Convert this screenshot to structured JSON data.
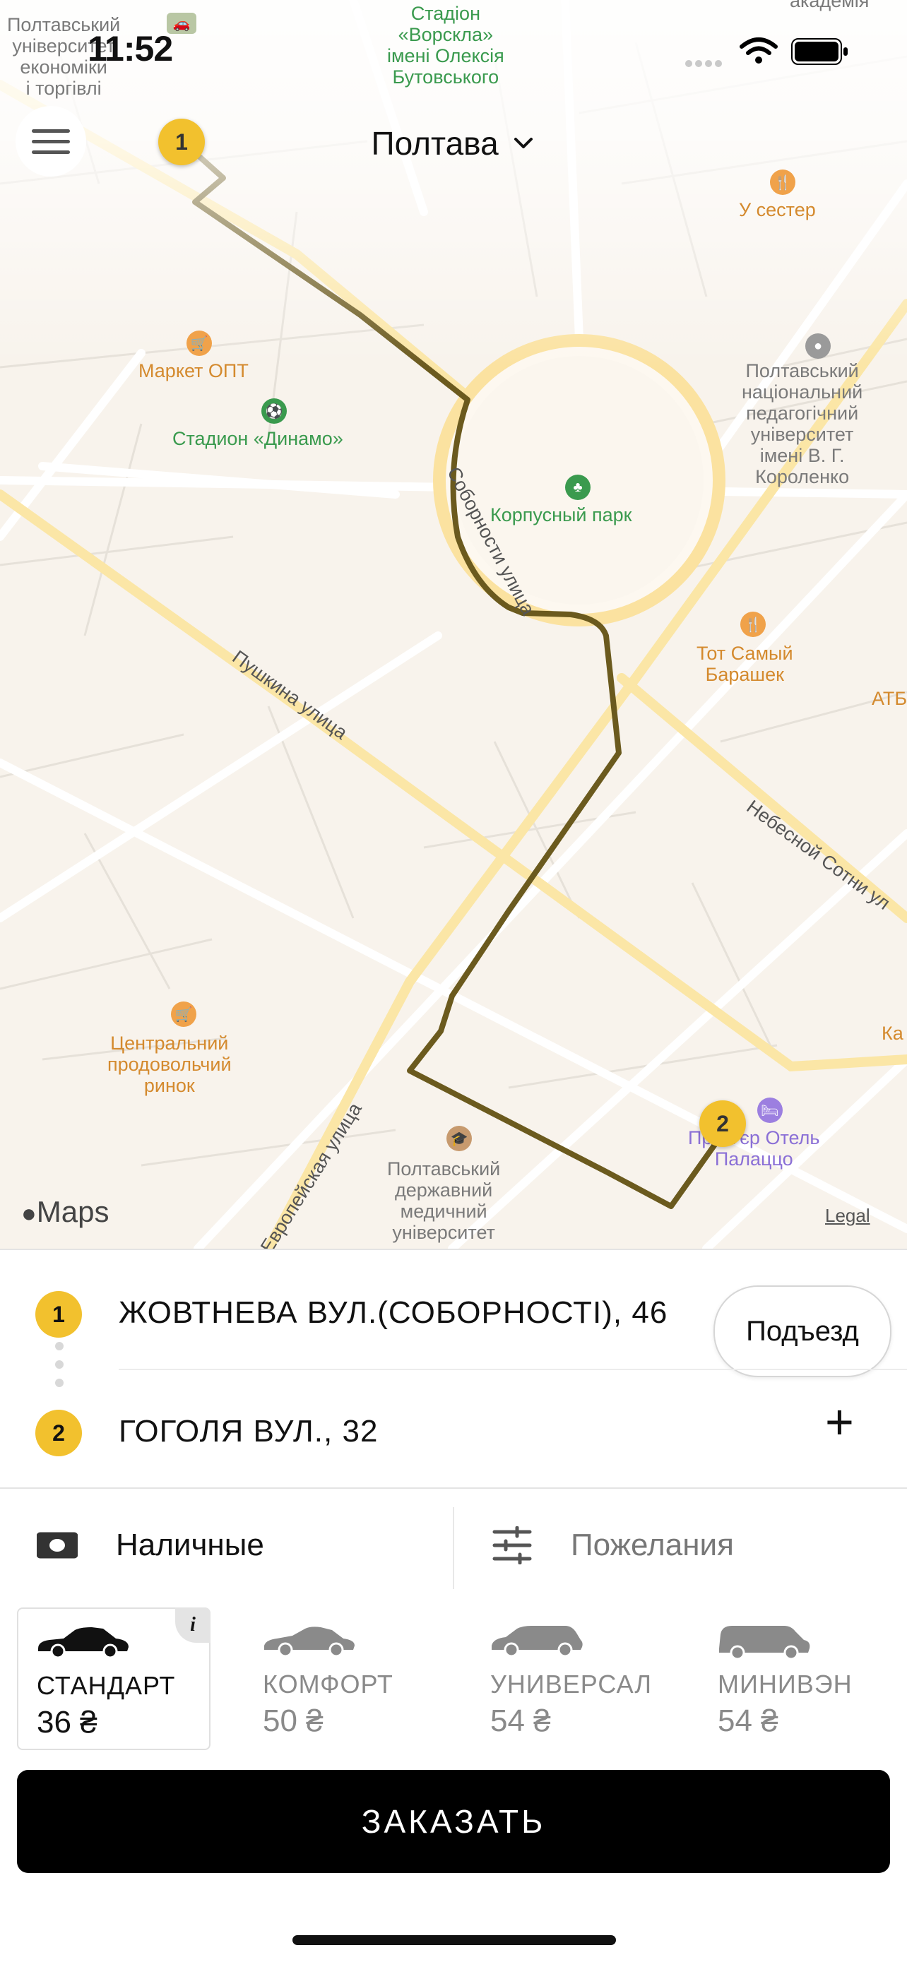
{
  "status_bar": {
    "time": "11:52"
  },
  "header": {
    "city": "Полтава"
  },
  "map": {
    "labels": {
      "top_left": "Полтавський\nуніверситет\nекономіки\nі торгівлі",
      "stadium_vorskla": "Стадіон\n«Ворскла»\nімені Олексія\nБутовського",
      "academy": "академія",
      "u_sester": "У сестер",
      "market_opt": "Маркет ОПТ",
      "stadium_dynamo": "Стадион «Динамо»",
      "pedagogical": "Полтавський\nнаціональний\nпедагогічний\nуніверситет\nімені В. Г.\nКороленко",
      "korpusny_park": "Корпусный парк",
      "tot_samy_barashek": "Тот Самый\nБарашек",
      "ate": "АТБ",
      "central_market": "Центральний\nпродовольчий\nринок",
      "medical_university": "Полтавський\nдержавний\nмедичний\nуніверситет",
      "hotel": "Прем'єр Отель\nПалаццо",
      "ka": "Ка"
    },
    "streets": {
      "sobornosti": "Соборности улица",
      "pushkina": "Пушкина улица",
      "nebesnoy_sotni": "Небесной Сотни ул",
      "evropeyskaya": "Европейская улица"
    },
    "pins": [
      "1",
      "2"
    ],
    "attribution": "Maps",
    "legal": "Legal",
    "route_color": "#6b5a1e"
  },
  "addresses": [
    {
      "index": "1",
      "text": "ЖОВТНЕВА  ВУЛ.(СОБОРНОСТІ), 46",
      "action": "Подъезд"
    },
    {
      "index": "2",
      "text": "ГОГОЛЯ ВУЛ., 32",
      "action": "+"
    }
  ],
  "options": {
    "payment": "Наличные",
    "preferences": "Пожелания"
  },
  "tariffs": [
    {
      "name": "СТАНДАРТ",
      "price": "36 ₴",
      "selected": true,
      "info": "i"
    },
    {
      "name": "КОМФОРТ",
      "price": "50 ₴",
      "selected": false
    },
    {
      "name": "УНИВЕРСАЛ",
      "price": "54 ₴",
      "selected": false
    },
    {
      "name": "МИНИВЭН",
      "price": "54 ₴",
      "selected": false
    }
  ],
  "order_button": "ЗАКАЗАТЬ",
  "colors": {
    "accent": "#f2c12e",
    "route": "#6b5a1e",
    "map_bg": "#f8f3ec"
  }
}
